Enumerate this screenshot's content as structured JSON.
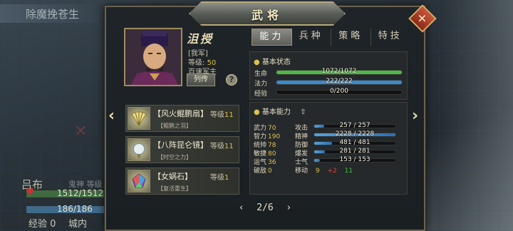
{
  "background": {
    "title": "除魔挽苍生",
    "unit_name": "吕布",
    "unit_sub": "鬼神 等级",
    "hp_text": "1512/1512",
    "mp_text": "186/186",
    "exp_label": "经验",
    "exp_value": "0",
    "city_label": "城内"
  },
  "panel": {
    "title": "武将",
    "close_icon": "close-icon"
  },
  "hero": {
    "name": "沮授",
    "faction": "[我军]",
    "level_label": "等级:",
    "level_value": "50",
    "unit_class": "百速军主",
    "bio_button": "列传",
    "help_button": "?"
  },
  "items": [
    {
      "name": "【风火鲲鹏扇】",
      "level_label": "等级",
      "level_value": "11",
      "sub": "【鲲鹏之羽】",
      "icon": "fan-icon"
    },
    {
      "name": "【八阵昆仑镜】",
      "level_label": "等级",
      "level_value": "11",
      "sub": "【时空之力】",
      "icon": "mirror-icon"
    },
    {
      "name": "【女娲石】",
      "level_label": "等级",
      "level_value": "1",
      "sub": "【复活重生】",
      "icon": "gem-icon"
    }
  ],
  "pager": {
    "prev": "‹",
    "current": "2/6",
    "next": "›"
  },
  "nav": {
    "left": "‹",
    "right": "›"
  },
  "tabs": [
    {
      "label": "能力",
      "active": true
    },
    {
      "label": "兵种",
      "active": false
    },
    {
      "label": "策略",
      "active": false
    },
    {
      "label": "特技",
      "active": false
    }
  ],
  "basic_status": {
    "title": "基本状态",
    "rows": [
      {
        "label": "生命",
        "value": "1072/1072",
        "fraction": 1.0,
        "color": "#4fb848"
      },
      {
        "label": "法力",
        "value": "222/222",
        "fraction": 1.0,
        "color": "#3a8ad0"
      },
      {
        "label": "经验",
        "value": "0/200",
        "fraction": 0.0,
        "color": "#c0a040"
      }
    ]
  },
  "basic_ability": {
    "title": "基本能力",
    "up_icon": "arrow-up-icon",
    "abilities": [
      {
        "label": "武力",
        "value": "70"
      },
      {
        "label": "智力",
        "value": "190"
      },
      {
        "label": "统帅",
        "value": "78"
      },
      {
        "label": "敏捷",
        "value": "80"
      },
      {
        "label": "运气",
        "value": "36"
      },
      {
        "label": "破敌",
        "value": "0"
      }
    ],
    "sub_stats": [
      {
        "label": "攻击",
        "value": "257 / 257",
        "fraction": 0.12
      },
      {
        "label": "精神",
        "value": "2228 / 2228",
        "fraction": 1.0
      },
      {
        "label": "防御",
        "value": "481 / 481",
        "fraction": 0.22
      },
      {
        "label": "爆发",
        "value": "281 / 281",
        "fraction": 0.13
      },
      {
        "label": "士气",
        "value": "153 / 153",
        "fraction": 0.07
      }
    ],
    "move": {
      "label": "移动",
      "base": "9",
      "bonus": "+2",
      "total": "11"
    }
  }
}
